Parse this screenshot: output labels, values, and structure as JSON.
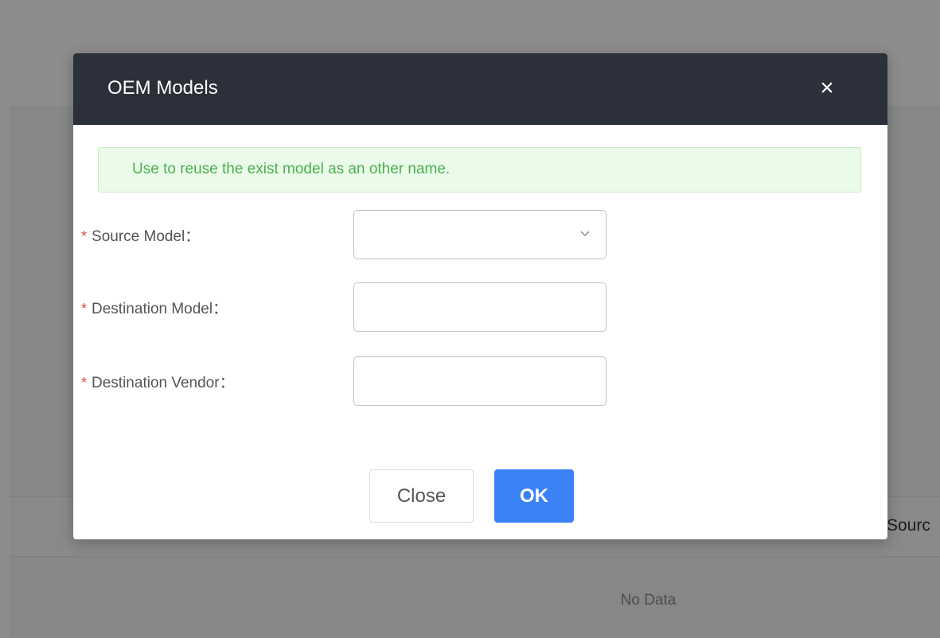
{
  "background": {
    "column_header": "Sourc",
    "empty_text": "No Data"
  },
  "modal": {
    "title": "OEM Models",
    "close_glyph": "×",
    "alert": "Use to reuse the exist model as an other name.",
    "required_mark": "*",
    "fields": {
      "source_model": {
        "label": "Source Model：",
        "value": ""
      },
      "destination_model": {
        "label": "Destination Model：",
        "value": ""
      },
      "destination_vendor": {
        "label": "Destination Vendor：",
        "value": ""
      }
    },
    "buttons": {
      "close": "Close",
      "ok": "OK"
    }
  },
  "colors": {
    "header_bg": "#2c303b",
    "alert_bg": "#eafbe9",
    "alert_text": "#4caf50",
    "required": "#e0474c",
    "primary": "#3b82f6"
  },
  "icons": {
    "close": "close-icon",
    "select": "chevron-down-icon"
  }
}
